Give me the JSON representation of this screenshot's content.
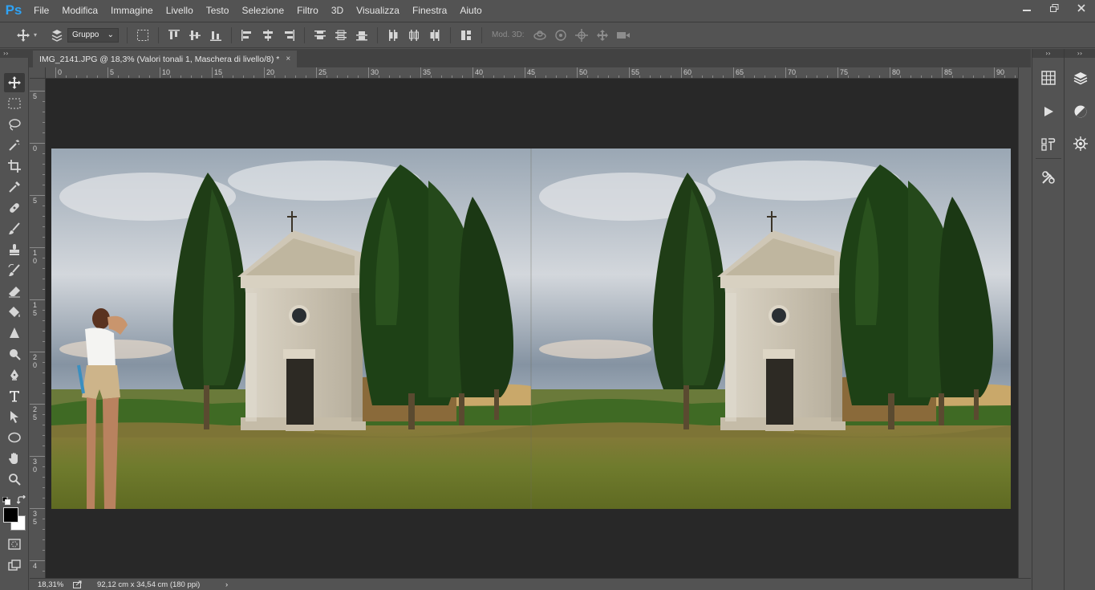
{
  "app": {
    "logo": "Ps"
  },
  "menu": [
    "File",
    "Modifica",
    "Immagine",
    "Livello",
    "Testo",
    "Selezione",
    "Filtro",
    "3D",
    "Visualizza",
    "Finestra",
    "Aiuto"
  ],
  "options": {
    "auto_select_value": "Gruppo",
    "mode_3d_label": "Mod. 3D:"
  },
  "document": {
    "tab_title": "IMG_2141.JPG @ 18,3% (Valori tonali 1, Maschera di livello/8) *",
    "close_label": "×"
  },
  "ruler_top": [
    "0",
    "5",
    "10",
    "15",
    "20",
    "25",
    "30",
    "35",
    "40",
    "45",
    "50",
    "55",
    "60",
    "65",
    "70",
    "75",
    "80",
    "85",
    "90"
  ],
  "ruler_left": [
    [
      "5"
    ],
    [
      "0"
    ],
    [
      "5"
    ],
    [
      "1",
      "0"
    ],
    [
      "1",
      "5"
    ],
    [
      "2",
      "0"
    ],
    [
      "2",
      "5"
    ],
    [
      "3",
      "0"
    ],
    [
      "3",
      "5"
    ],
    [
      "4"
    ]
  ],
  "status": {
    "zoom": "18,31%",
    "doc_size": "92,12 cm x 34,54 cm (180 ppi)",
    "arrow": "›"
  },
  "panel_collapse": "››",
  "toolbar_collapse": "››",
  "colors": {
    "foreground": "#000000",
    "background": "#ffffff",
    "accent": "#2fa3f5"
  }
}
